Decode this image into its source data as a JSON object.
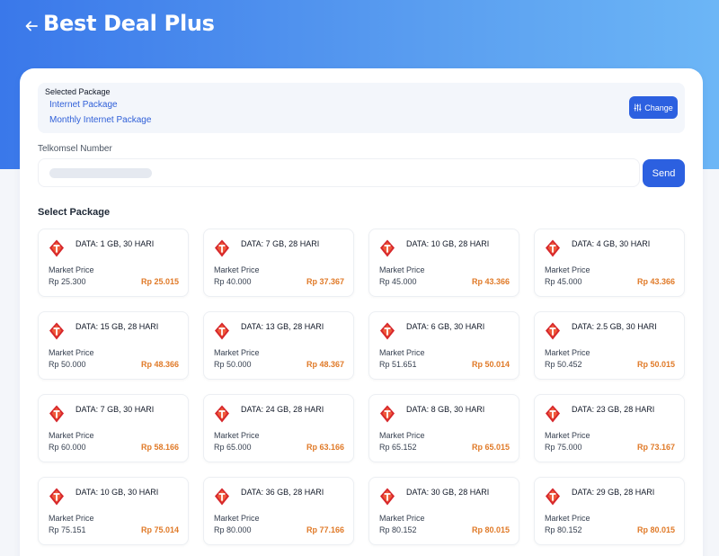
{
  "header": {
    "title": "Best Deal Plus"
  },
  "selected": {
    "title": "Selected Package",
    "lines": [
      "Internet Package",
      "Monthly Internet Package"
    ],
    "change_label": "Change"
  },
  "number": {
    "label": "Telkomsel Number",
    "send_label": "Send"
  },
  "packages_title": "Select Package",
  "market_price_label": "Market Price",
  "colors": {
    "accent": "#2c60e0",
    "price": "#e07a28",
    "brand": "#d6262b"
  },
  "packages": [
    {
      "name": "DATA: 1 GB, 30 HARI",
      "market": "Rp 25.300",
      "price": "Rp 25.015"
    },
    {
      "name": "DATA: 7 GB, 28 HARI",
      "market": "Rp 40.000",
      "price": "Rp 37.367"
    },
    {
      "name": "DATA: 10 GB, 28 HARI",
      "market": "Rp 45.000",
      "price": "Rp 43.366"
    },
    {
      "name": "DATA: 4 GB, 30 HARI",
      "market": "Rp 45.000",
      "price": "Rp 43.366"
    },
    {
      "name": "DATA: 15 GB, 28 HARI",
      "market": "Rp 50.000",
      "price": "Rp 48.366"
    },
    {
      "name": "DATA: 13 GB, 28 HARI",
      "market": "Rp 50.000",
      "price": "Rp 48.367"
    },
    {
      "name": "DATA: 6 GB, 30 HARI",
      "market": "Rp 51.651",
      "price": "Rp 50.014"
    },
    {
      "name": "DATA: 2.5 GB, 30 HARI",
      "market": "Rp 50.452",
      "price": "Rp 50.015"
    },
    {
      "name": "DATA: 7 GB, 30 HARI",
      "market": "Rp 60.000",
      "price": "Rp 58.166"
    },
    {
      "name": "DATA: 24 GB, 28 HARI",
      "market": "Rp 65.000",
      "price": "Rp 63.166"
    },
    {
      "name": "DATA: 8 GB, 30 HARI",
      "market": "Rp 65.152",
      "price": "Rp 65.015"
    },
    {
      "name": "DATA: 23 GB, 28 HARI",
      "market": "Rp 75.000",
      "price": "Rp 73.167"
    },
    {
      "name": "DATA: 10 GB, 30 HARI",
      "market": "Rp 75.151",
      "price": "Rp 75.014"
    },
    {
      "name": "DATA: 36 GB, 28 HARI",
      "market": "Rp 80.000",
      "price": "Rp 77.166"
    },
    {
      "name": "DATA: 30 GB, 28 HARI",
      "market": "Rp 80.152",
      "price": "Rp 80.015"
    },
    {
      "name": "DATA: 29 GB, 28 HARI",
      "market": "Rp 80.152",
      "price": "Rp 80.015"
    }
  ]
}
